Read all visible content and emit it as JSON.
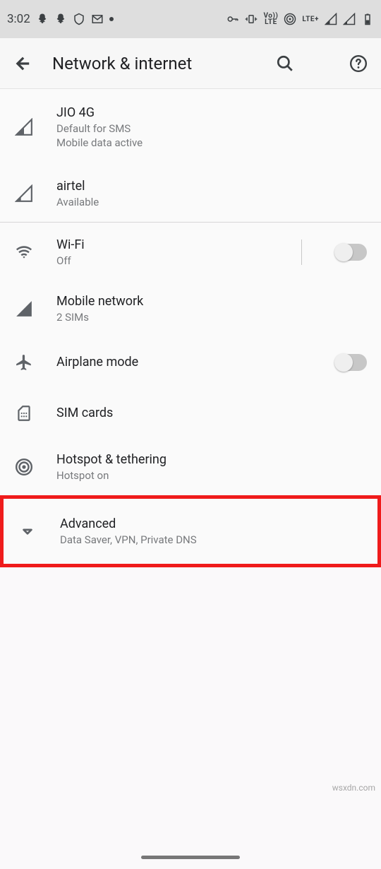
{
  "status": {
    "time": "3:02",
    "lte_label": "LTE+",
    "volte_label": "Vo))\nLTE"
  },
  "header": {
    "title": "Network & internet"
  },
  "sim_section": {
    "items": [
      {
        "title": "JIO 4G",
        "line1": "Default for SMS",
        "line2": "Mobile data active"
      },
      {
        "title": "airtel",
        "line1": "Available"
      }
    ]
  },
  "settings": {
    "wifi": {
      "title": "Wi-Fi",
      "subtitle": "Off"
    },
    "mobile_network": {
      "title": "Mobile network",
      "subtitle": "2 SIMs"
    },
    "airplane": {
      "title": "Airplane mode"
    },
    "sim_cards": {
      "title": "SIM cards"
    },
    "hotspot": {
      "title": "Hotspot & tethering",
      "subtitle": "Hotspot on"
    },
    "advanced": {
      "title": "Advanced",
      "subtitle": "Data Saver, VPN, Private DNS"
    }
  },
  "watermark": "wsxdn.com"
}
